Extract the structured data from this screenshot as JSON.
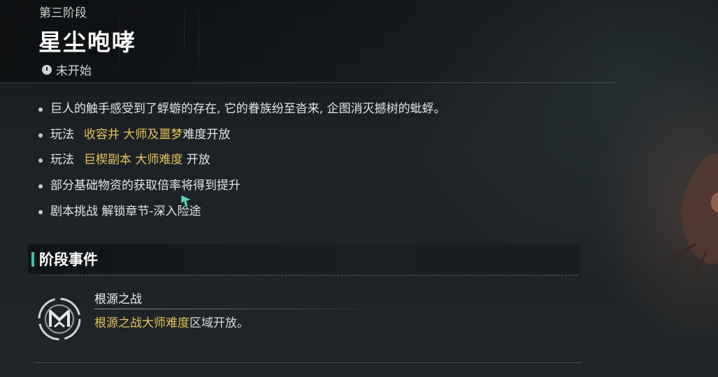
{
  "header": {
    "phase_label": "第三阶段",
    "title": "星尘咆哮",
    "status_icon": "clock-icon",
    "status_text": "未开始"
  },
  "bullets": [
    {
      "segments": [
        {
          "text": "巨人的触手感受到了蜉蝣的存在, 它的眷族纷至沓来, 企图消灭撼树的蚍蜉。",
          "highlight": false
        }
      ]
    },
    {
      "segments": [
        {
          "text": "玩法",
          "highlight": false
        },
        {
          "text": "收容井 大师及噩梦",
          "highlight": true
        },
        {
          "text": "难度开放",
          "highlight": false
        }
      ]
    },
    {
      "segments": [
        {
          "text": "玩法",
          "highlight": false
        },
        {
          "text": "巨楔副本 大师难度",
          "highlight": true
        },
        {
          "text": " 开放",
          "highlight": false
        }
      ]
    },
    {
      "segments": [
        {
          "text": "部分基础物资的获取倍率将得到提升",
          "highlight": false
        }
      ]
    },
    {
      "segments": [
        {
          "text": "剧本挑战 解锁章节-深入险途",
          "highlight": false
        }
      ]
    }
  ],
  "section": {
    "title": "阶段事件"
  },
  "event": {
    "icon": "emblem-icon",
    "name": "根源之战",
    "desc_highlight": "根源之战大师难度",
    "desc_rest": "区域开放。"
  },
  "colors": {
    "highlight": "#e8c25a",
    "accent": "#3fbfae",
    "text": "#e4e6e6"
  }
}
